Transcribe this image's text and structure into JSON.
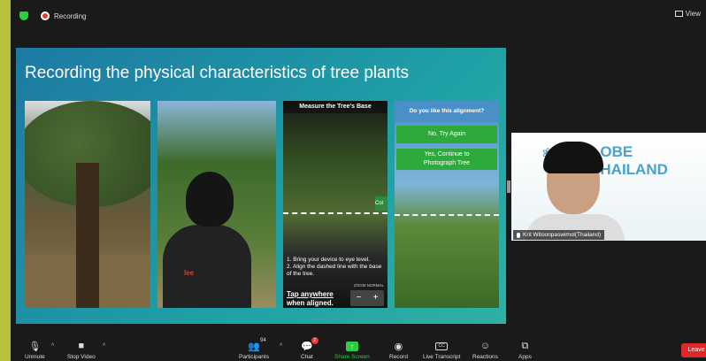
{
  "topbar": {
    "recording_label": "Recording",
    "view_label": "View"
  },
  "slide": {
    "title": "Recording the physical characteristics of tree plants",
    "photo2_logo": "lee",
    "app_screen": {
      "title": "Measure the Tree's Base",
      "side_tab": "Col",
      "instruction_1": "1. Bring your device to eye level.",
      "instruction_2": "2. Align the dashed line with the base of the tree.",
      "tap_line1": "Tap anywhere",
      "tap_line2": "when aligned.",
      "zoom_label": "ZOOM NORMAL",
      "zoom_minus": "−",
      "zoom_plus": "+"
    },
    "alignment_screen": {
      "question": "Do you like this alignment?",
      "no_button": "No, Try Again",
      "yes_button_line1": "Yes, Continue to",
      "yes_button_line2": "Photograph Tree"
    }
  },
  "video": {
    "brand_prefix": "⚛",
    "brand_text": "LOBE THAILAND",
    "participant_name": "Krit Witoonpaswimol(Thailand)"
  },
  "toolbar": {
    "unmute": "Unmute",
    "stop_video": "Stop Video",
    "participants": "Participants",
    "participants_count": "94",
    "chat": "Chat",
    "chat_badge": "2",
    "share_screen": "Share Screen",
    "record": "Record",
    "live_transcript": "Live Transcript",
    "cc": "CC",
    "reactions": "Reactions",
    "apps": "Apps",
    "leave": "Leave"
  }
}
